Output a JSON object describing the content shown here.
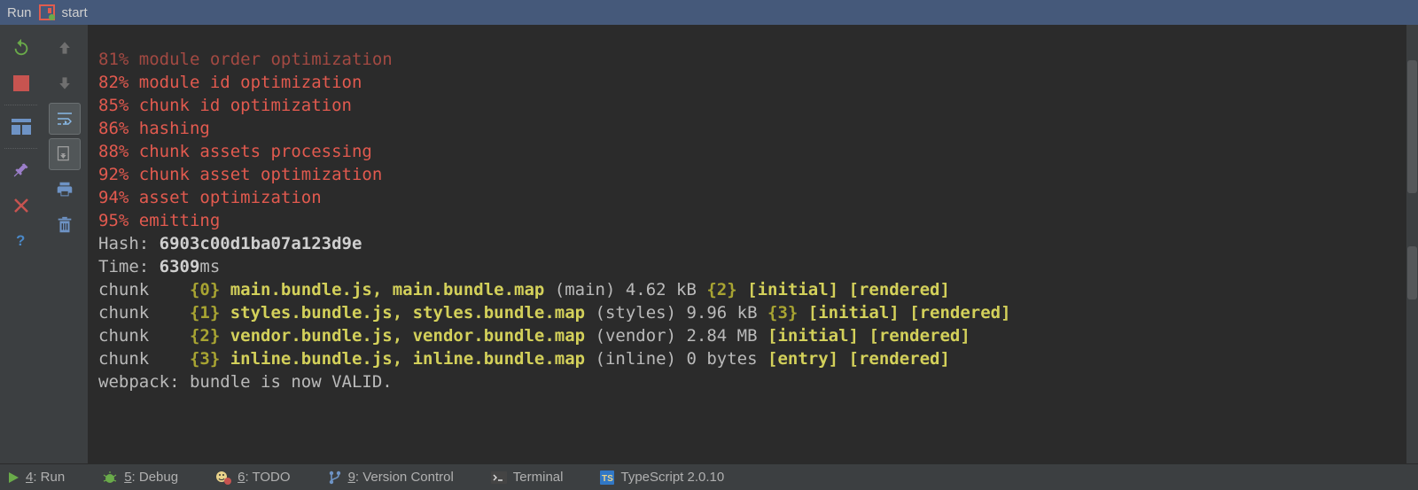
{
  "header": {
    "title": "Run",
    "config": "start"
  },
  "console": {
    "progress": [
      "81% module order optimization",
      "82% module id optimization",
      "85% chunk id optimization",
      "86% hashing",
      "88% chunk assets processing",
      "92% chunk asset optimization",
      "94% asset optimization",
      "95% emitting"
    ],
    "hash_label": "Hash: ",
    "hash_value": "6903c00d1ba07a123d9e",
    "time_label": "Time: ",
    "time_value": "6309",
    "time_unit": "ms",
    "chunks": [
      {
        "prefix": "chunk    ",
        "idx": "{0}",
        "files": " main.bundle.js, main.bundle.map",
        "paren": " (main) 4.62 kB ",
        "dep": "{2}",
        "flags": " [initial] [rendered]"
      },
      {
        "prefix": "chunk    ",
        "idx": "{1}",
        "files": " styles.bundle.js, styles.bundle.map",
        "paren": " (styles) 9.96 kB ",
        "dep": "{3}",
        "flags": " [initial] [rendered]"
      },
      {
        "prefix": "chunk    ",
        "idx": "{2}",
        "files": " vendor.bundle.js, vendor.bundle.map",
        "paren": " (vendor) 2.84 MB ",
        "dep": "",
        "flags": "[initial] [rendered]"
      },
      {
        "prefix": "chunk    ",
        "idx": "{3}",
        "files": " inline.bundle.js, inline.bundle.map",
        "paren": " (inline) 0 bytes ",
        "dep": "",
        "flags": "[entry] [rendered]"
      }
    ],
    "footer": "webpack: bundle is now VALID."
  },
  "bottombar": {
    "run": {
      "num": "4",
      "label": ": Run"
    },
    "debug": {
      "num": "5",
      "label": ": Debug"
    },
    "todo": {
      "num": "6",
      "label": ": TODO"
    },
    "vcs": {
      "num": "9",
      "label": ": Version Control"
    },
    "terminal": "Terminal",
    "typescript": "TypeScript 2.0.10"
  }
}
